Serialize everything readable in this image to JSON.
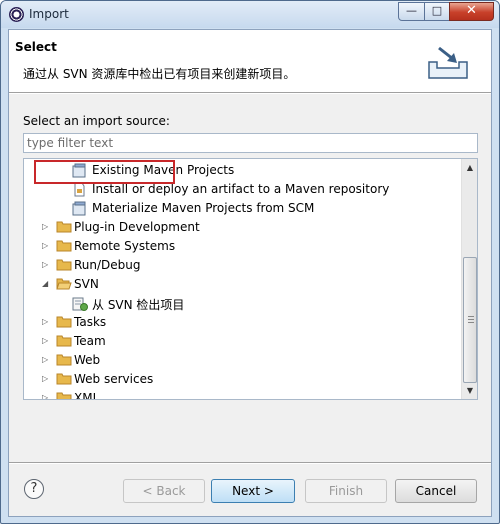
{
  "window": {
    "title": "Import"
  },
  "header": {
    "title": "Select",
    "description": "通过从 SVN 资源库中检出已有项目来创建新项目。"
  },
  "source": {
    "label": "Select an import source:",
    "filter_placeholder": "type filter text"
  },
  "tree": {
    "items": [
      {
        "label": "Existing Maven Projects",
        "icon": "maven-projects-icon",
        "level": 2
      },
      {
        "label": "Install or deploy an artifact to a Maven repository",
        "icon": "artifact-file-icon",
        "level": 2
      },
      {
        "label": "Materialize Maven Projects from SCM",
        "icon": "maven-projects-icon",
        "level": 2
      },
      {
        "label": "Plug-in Development",
        "icon": "folder-icon",
        "level": 1,
        "expanded": false
      },
      {
        "label": "Remote Systems",
        "icon": "folder-icon",
        "level": 1,
        "expanded": false
      },
      {
        "label": "Run/Debug",
        "icon": "folder-icon",
        "level": 1,
        "expanded": false
      },
      {
        "label": "SVN",
        "icon": "folder-icon",
        "level": 1,
        "expanded": true
      },
      {
        "label": "从 SVN 检出项目",
        "icon": "svn-checkout-icon",
        "level": 2,
        "selected": true
      },
      {
        "label": "Tasks",
        "icon": "folder-icon",
        "level": 1,
        "expanded": false
      },
      {
        "label": "Team",
        "icon": "folder-icon",
        "level": 1,
        "expanded": false
      },
      {
        "label": "Web",
        "icon": "folder-icon",
        "level": 1,
        "expanded": false
      },
      {
        "label": "Web services",
        "icon": "folder-icon",
        "level": 1,
        "expanded": false
      },
      {
        "label": "XML",
        "icon": "folder-icon",
        "level": 1,
        "expanded": false
      }
    ]
  },
  "buttons": {
    "help": "?",
    "back": "< Back",
    "next": "Next >",
    "finish": "Finish",
    "cancel": "Cancel"
  },
  "colors": {
    "highlight_border": "#c8282a",
    "folder": "#e7b84c",
    "default_button": "#bedff6"
  }
}
